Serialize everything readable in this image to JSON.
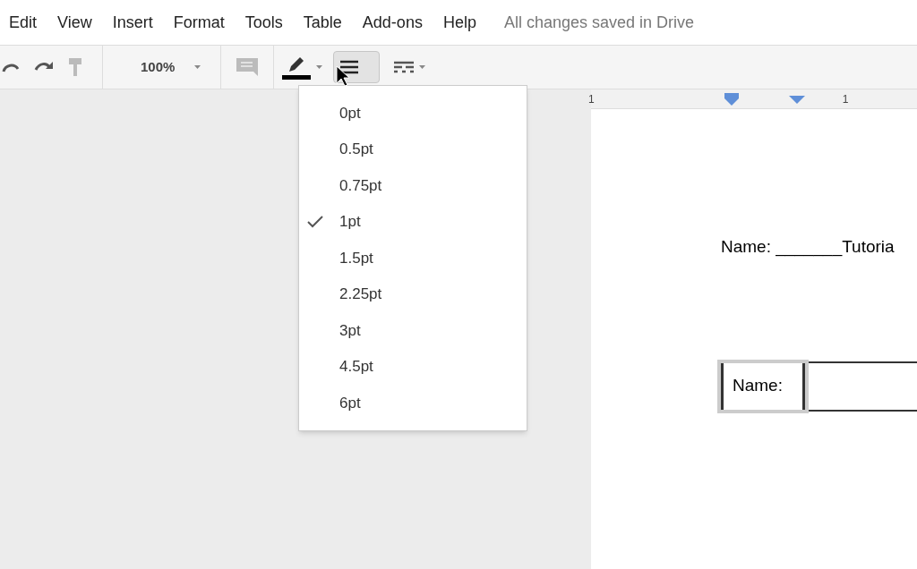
{
  "menu_bar": {
    "items": [
      "Edit",
      "View",
      "Insert",
      "Format",
      "Tools",
      "Table",
      "Add-ons",
      "Help"
    ],
    "status": "All changes saved in Drive"
  },
  "toolbar": {
    "zoom": "100%",
    "border_weight_pressed": true
  },
  "border_weight_menu": [
    {
      "label": "0pt",
      "selected": false
    },
    {
      "label": "0.5pt",
      "selected": false
    },
    {
      "label": "0.75pt",
      "selected": false
    },
    {
      "label": "1pt",
      "selected": true
    },
    {
      "label": "1.5pt",
      "selected": false
    },
    {
      "label": "2.25pt",
      "selected": false
    },
    {
      "label": "3pt",
      "selected": false
    },
    {
      "label": "4.5pt",
      "selected": false
    },
    {
      "label": "6pt",
      "selected": false
    }
  ],
  "ruler": {
    "labels": [
      "1",
      "1"
    ]
  },
  "document": {
    "line": "Name: _______Tutoria",
    "table_cell": "Name:"
  }
}
